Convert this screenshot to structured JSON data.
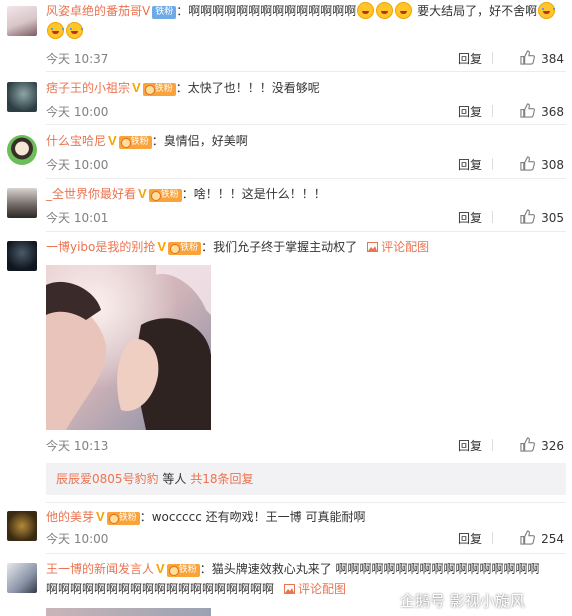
{
  "comments": [
    {
      "username": "风姿卓绝的番茄哥V",
      "badge": "铁粉",
      "text": "：啊啊啊啊啊啊啊啊啊啊啊啊啊啊",
      "text2": "要大结局了，好不舍啊",
      "time": "今天 10:37",
      "reply": "回复",
      "likes": "384"
    },
    {
      "username": "痞子王的小祖宗",
      "badge": "铁粉",
      "text": "：太快了也！！！没看够呢",
      "time": "今天 10:00",
      "reply": "回复",
      "likes": "368"
    },
    {
      "username": "什么宝哈尼",
      "badge": "铁粉",
      "text": "：臭情侣，好美啊",
      "time": "今天 10:00",
      "reply": "回复",
      "likes": "308"
    },
    {
      "username": "_全世界你最好看",
      "badge": "铁粉",
      "text": "：啥！！！这是什么！！！",
      "time": "今天 10:01",
      "reply": "回复",
      "likes": "305"
    },
    {
      "username": "一博yibo是我的别抢",
      "badge": "铁粉",
      "text": "：我们允子终于掌握主动权了",
      "pic_label": "评论配图",
      "time": "今天 10:13",
      "reply": "回复",
      "likes": "326",
      "sub_user": "辰辰爱0805号豹豹",
      "sub_text": " 等人 ",
      "sub_count": "共18条回复"
    },
    {
      "username": "他的美芽",
      "badge": "铁粉",
      "text": "：woccccc  还有吻戏！王一博 可真能耐啊",
      "time": "今天 10:00",
      "reply": "回复",
      "likes": "254"
    },
    {
      "username": "王一博的新闻发言人",
      "badge": "铁粉",
      "text": "：猫头牌速效救心丸来了  啊啊啊啊啊啊啊啊啊啊啊啊啊啊啊啊啊",
      "text2": "啊啊啊啊啊啊啊啊啊啊啊啊啊啊啊啊啊啊啊",
      "pic_label": "评论配图"
    }
  ],
  "watermark": "企鹅号 影视小旋风",
  "colors": {
    "username": "#eb7350",
    "meta": "#808080",
    "divider": "#ececec",
    "vip": "#f7a400"
  }
}
